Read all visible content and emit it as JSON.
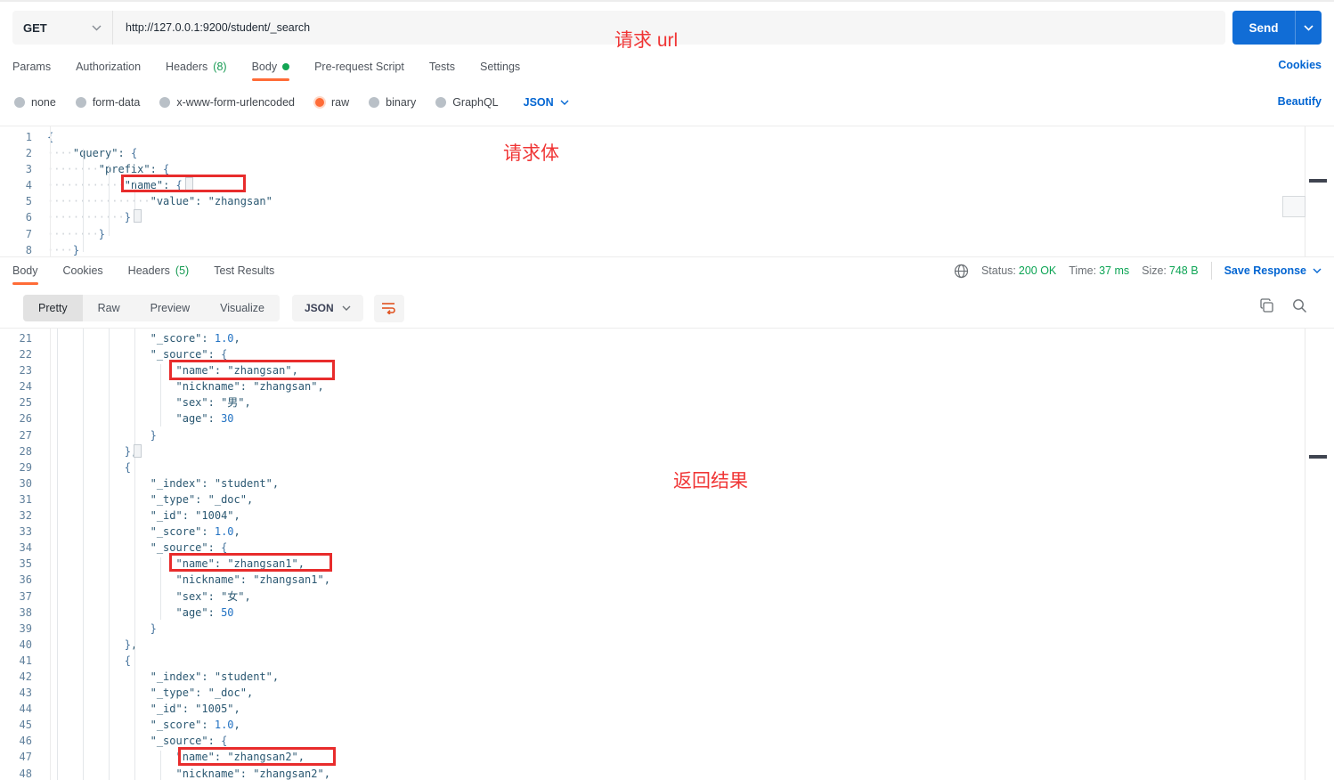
{
  "annotations": {
    "url_label": "请求 url",
    "body_label": "请求体",
    "result_label": "返回结果"
  },
  "request": {
    "method": "GET",
    "url": "http://127.0.0.1:9200/student/_search",
    "send_label": "Send",
    "cookies_link": "Cookies",
    "beautify_link": "Beautify",
    "tabs": [
      {
        "label": "Params"
      },
      {
        "label": "Authorization"
      },
      {
        "label": "Headers",
        "count": "(8)"
      },
      {
        "label": "Body",
        "active": true,
        "dot": true
      },
      {
        "label": "Pre-request Script"
      },
      {
        "label": "Tests"
      },
      {
        "label": "Settings"
      }
    ],
    "body_modes": [
      {
        "label": "none"
      },
      {
        "label": "form-data"
      },
      {
        "label": "x-www-form-urlencoded"
      },
      {
        "label": "raw",
        "selected": true
      },
      {
        "label": "binary"
      },
      {
        "label": "GraphQL"
      }
    ],
    "raw_type": "JSON",
    "editor_lines": [
      {
        "n": 1,
        "t": "{"
      },
      {
        "n": 2,
        "t": "    \"query\": {"
      },
      {
        "n": 3,
        "t": "        \"prefix\": {"
      },
      {
        "n": 4,
        "t": "            \"name\": {"
      },
      {
        "n": 5,
        "t": "                \"value\": \"zhangsan\""
      },
      {
        "n": 6,
        "t": "            }"
      },
      {
        "n": 7,
        "t": "        }"
      },
      {
        "n": 8,
        "t": "    }"
      }
    ]
  },
  "response": {
    "tabs": [
      {
        "label": "Body",
        "active": true
      },
      {
        "label": "Cookies"
      },
      {
        "label": "Headers",
        "count": "(5)"
      },
      {
        "label": "Test Results"
      }
    ],
    "status_label": "Status:",
    "status_value": "200 OK",
    "time_label": "Time:",
    "time_value": "37 ms",
    "size_label": "Size:",
    "size_value": "748 B",
    "save_label": "Save Response",
    "view_modes": [
      {
        "label": "Pretty",
        "active": true
      },
      {
        "label": "Raw"
      },
      {
        "label": "Preview"
      },
      {
        "label": "Visualize"
      }
    ],
    "format": "JSON",
    "editor_lines": [
      {
        "n": 21,
        "t": "                \"_score\": 1.0,"
      },
      {
        "n": 22,
        "t": "                \"_source\": {"
      },
      {
        "n": 23,
        "t": "                    \"name\": \"zhangsan\","
      },
      {
        "n": 24,
        "t": "                    \"nickname\": \"zhangsan\","
      },
      {
        "n": 25,
        "t": "                    \"sex\": \"男\","
      },
      {
        "n": 26,
        "t": "                    \"age\": 30"
      },
      {
        "n": 27,
        "t": "                }"
      },
      {
        "n": 28,
        "t": "            },"
      },
      {
        "n": 29,
        "t": "            {"
      },
      {
        "n": 30,
        "t": "                \"_index\": \"student\","
      },
      {
        "n": 31,
        "t": "                \"_type\": \"_doc\","
      },
      {
        "n": 32,
        "t": "                \"_id\": \"1004\","
      },
      {
        "n": 33,
        "t": "                \"_score\": 1.0,"
      },
      {
        "n": 34,
        "t": "                \"_source\": {"
      },
      {
        "n": 35,
        "t": "                    \"name\": \"zhangsan1\","
      },
      {
        "n": 36,
        "t": "                    \"nickname\": \"zhangsan1\","
      },
      {
        "n": 37,
        "t": "                    \"sex\": \"女\","
      },
      {
        "n": 38,
        "t": "                    \"age\": 50"
      },
      {
        "n": 39,
        "t": "                }"
      },
      {
        "n": 40,
        "t": "            },"
      },
      {
        "n": 41,
        "t": "            {"
      },
      {
        "n": 42,
        "t": "                \"_index\": \"student\","
      },
      {
        "n": 43,
        "t": "                \"_type\": \"_doc\","
      },
      {
        "n": 44,
        "t": "                \"_id\": \"1005\","
      },
      {
        "n": 45,
        "t": "                \"_score\": 1.0,"
      },
      {
        "n": 46,
        "t": "                \"_source\": {"
      },
      {
        "n": 47,
        "t": "                    \"name\": \"zhangsan2\","
      },
      {
        "n": 48,
        "t": "                    \"nickname\": \"zhangsan2\","
      }
    ]
  },
  "colors": {
    "accent_orange": "#ff6c37",
    "accent_blue": "#0265d2",
    "send_blue": "#116dd6",
    "status_green": "#0ca454",
    "annotation_red": "#f03535"
  }
}
